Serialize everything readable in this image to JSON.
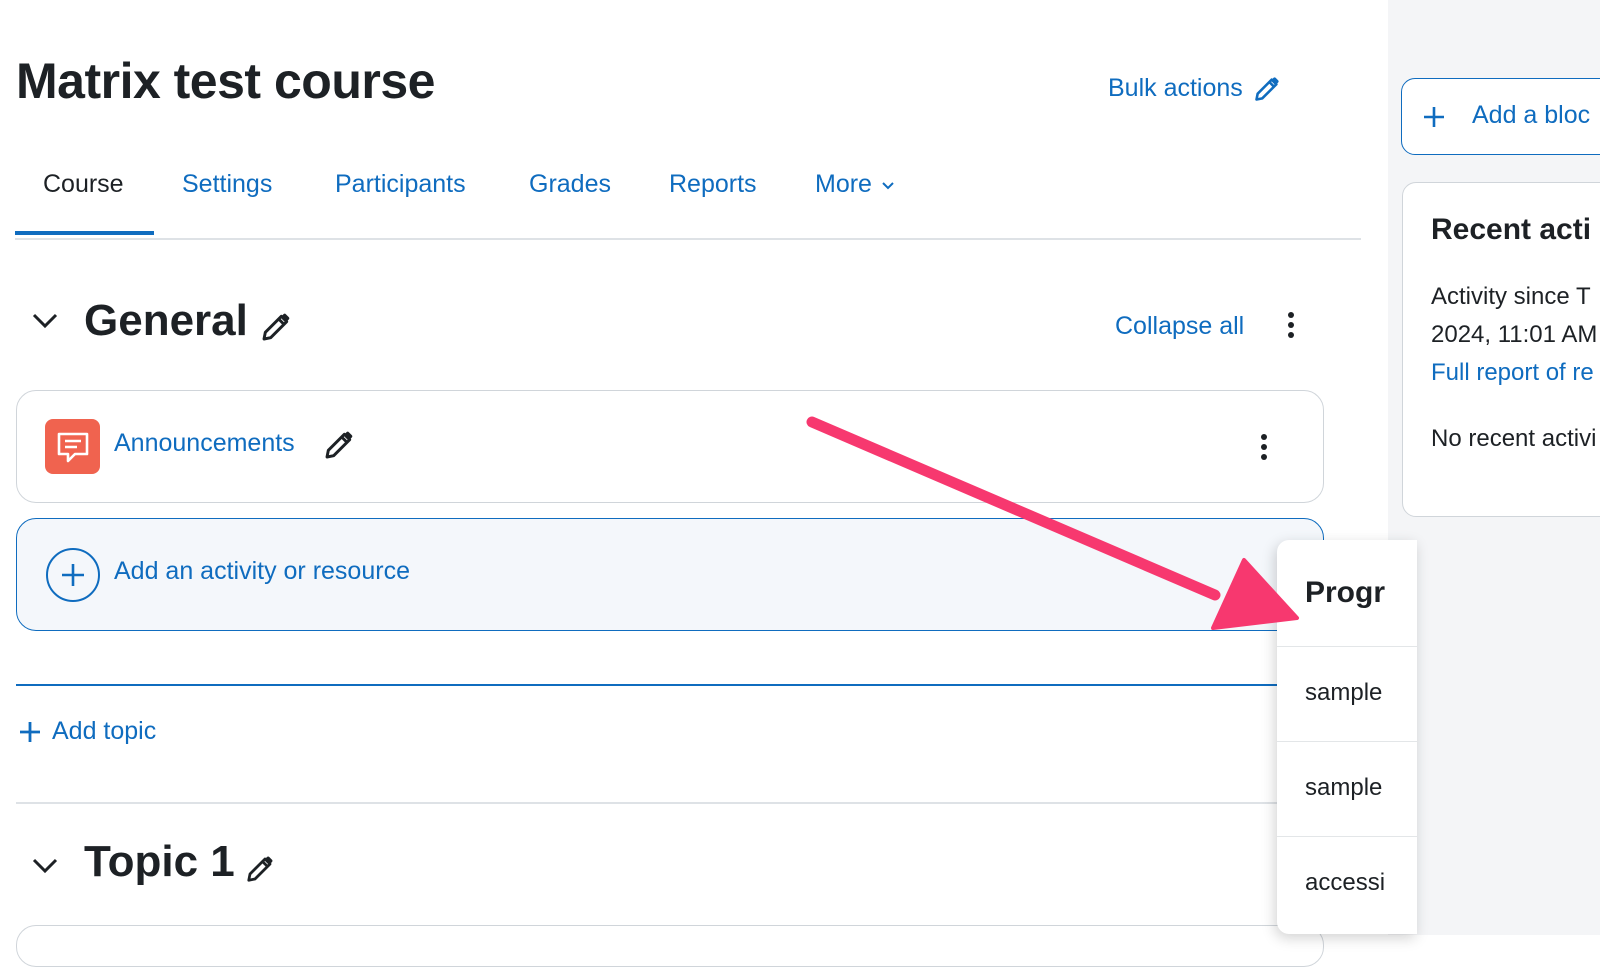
{
  "course": {
    "title": "Matrix test course",
    "bulk_actions": "Bulk actions"
  },
  "tabs": [
    {
      "label": "Course",
      "active": true
    },
    {
      "label": "Settings"
    },
    {
      "label": "Participants"
    },
    {
      "label": "Grades"
    },
    {
      "label": "Reports"
    },
    {
      "label": "More"
    }
  ],
  "general": {
    "title": "General",
    "collapse_all": "Collapse all",
    "activity": {
      "label": "Announcements",
      "icon": "forum-icon"
    },
    "add_activity": "Add an activity or resource",
    "add_topic": "Add topic"
  },
  "topic1": {
    "title": "Topic 1"
  },
  "popover": {
    "header": "Progr",
    "items": [
      "sample",
      "sample",
      "accessi"
    ]
  },
  "drawer": {
    "add_block": "Add a bloc",
    "recent": {
      "title": "Recent acti",
      "since_line1": "Activity since T",
      "since_line2": "2024, 11:01 AM",
      "full_report": "Full report of re",
      "none": "No recent activi"
    }
  },
  "colors": {
    "link": "#0f6cbf",
    "forum_icon_bg": "#f0634f",
    "arrow": "#f7386f"
  }
}
